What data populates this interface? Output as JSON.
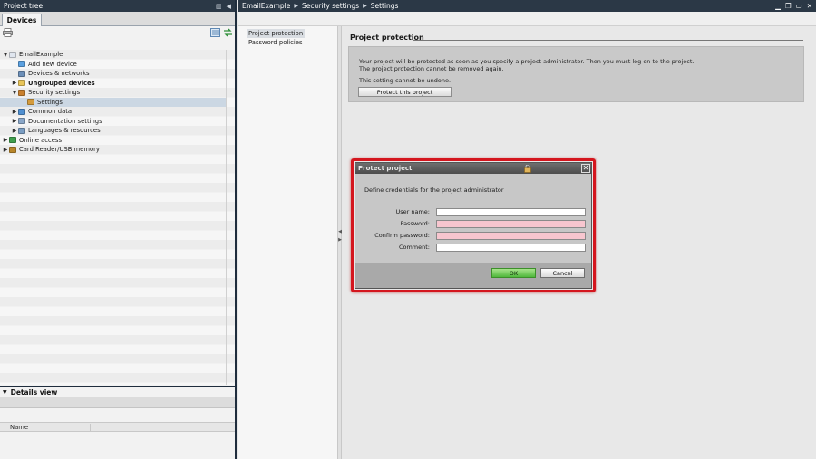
{
  "left_pane": {
    "title": "Project tree",
    "tab": "Devices",
    "tree": [
      {
        "label": "EmailExample",
        "depth": 0,
        "caret": "▼",
        "icon_color": "#e0e6ef",
        "bold": false,
        "selected": false
      },
      {
        "label": "Add new device",
        "depth": 1,
        "caret": "",
        "icon_color": "#5aa0e0",
        "bold": false,
        "selected": false
      },
      {
        "label": "Devices & networks",
        "depth": 1,
        "caret": "",
        "icon_color": "#6c8fb8",
        "bold": false,
        "selected": false
      },
      {
        "label": "Ungrouped devices",
        "depth": 1,
        "caret": "▶",
        "icon_color": "#e8c55a",
        "bold": true,
        "selected": false
      },
      {
        "label": "Security settings",
        "depth": 1,
        "caret": "▼",
        "icon_color": "#c9802e",
        "bold": false,
        "selected": false
      },
      {
        "label": "Settings",
        "depth": 2,
        "caret": "",
        "icon_color": "#d49b3c",
        "bold": false,
        "selected": true
      },
      {
        "label": "Common data",
        "depth": 1,
        "caret": "▶",
        "icon_color": "#4f8fd0",
        "bold": false,
        "selected": false
      },
      {
        "label": "Documentation settings",
        "depth": 1,
        "caret": "▶",
        "icon_color": "#8aa7c8",
        "bold": false,
        "selected": false
      },
      {
        "label": "Languages & resources",
        "depth": 1,
        "caret": "▶",
        "icon_color": "#7a9dc2",
        "bold": false,
        "selected": false
      },
      {
        "label": "Online access",
        "depth": 0,
        "caret": "▶",
        "icon_color": "#3f9e4d",
        "bold": false,
        "selected": false
      },
      {
        "label": "Card Reader/USB memory",
        "depth": 0,
        "caret": "▶",
        "icon_color": "#b8862a",
        "bold": false,
        "selected": false
      }
    ],
    "details": {
      "title": "Details view",
      "column_name": "Name"
    }
  },
  "header": {
    "crumbs": [
      "EmailExample",
      "Security settings",
      "Settings"
    ]
  },
  "sidenav": {
    "items": [
      {
        "label": "Project protection",
        "active": true
      },
      {
        "label": "Password policies",
        "active": false
      }
    ]
  },
  "protection": {
    "title": "Project protection",
    "description": "Your project will be protected as soon as you specify a project administrator. Then you must log on to the project. The project protection cannot be removed again.",
    "undo_note": "This setting cannot be undone.",
    "button_label": "Protect this project"
  },
  "dialog": {
    "title": "Protect project",
    "intro": "Define credentials for the project administrator",
    "fields": {
      "username_label": "User name:",
      "username_value": "",
      "password_label": "Password:",
      "password_value": "",
      "confirm_label": "Confirm password:",
      "confirm_value": "",
      "comment_label": "Comment:",
      "comment_value": ""
    },
    "ok_label": "OK",
    "cancel_label": "Cancel"
  }
}
